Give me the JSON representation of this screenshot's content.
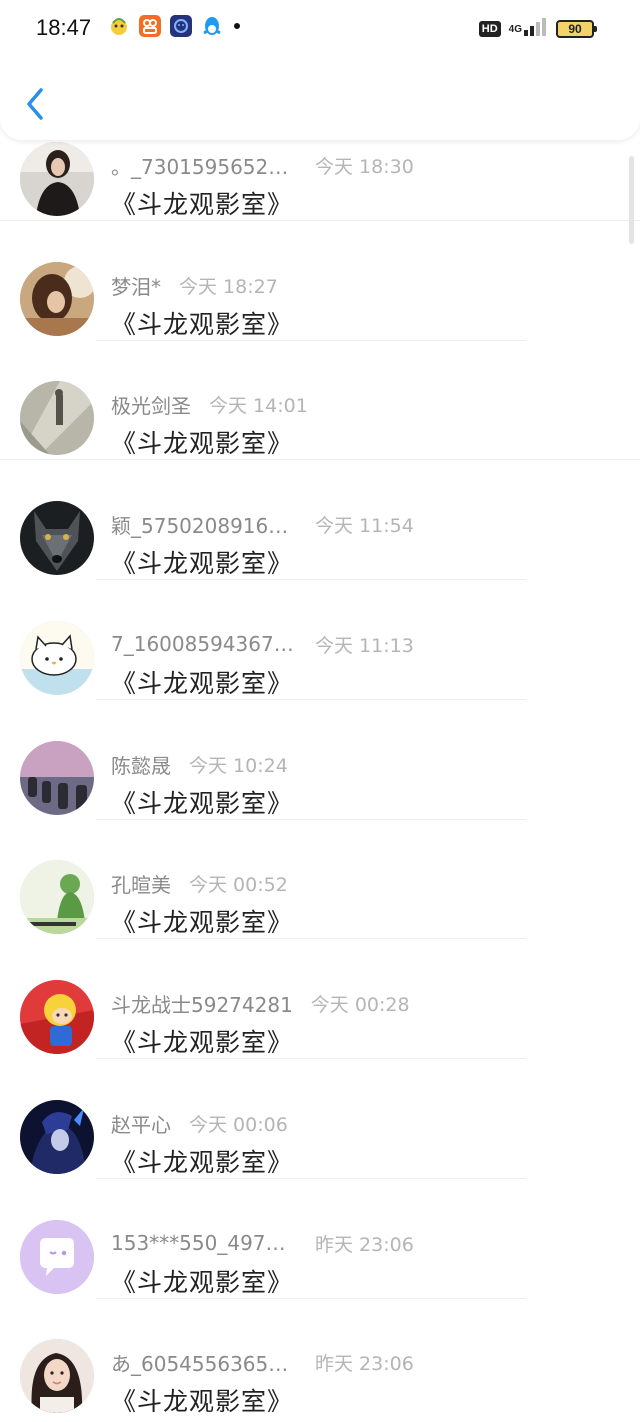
{
  "status_bar": {
    "time": "18:47",
    "hd": "HD",
    "network": "4G",
    "battery": "90"
  },
  "header": {
    "back_icon": "chevron-left-icon"
  },
  "messages": [
    {
      "name": "。_730159565233...",
      "time": "今天 18:30",
      "text": "《斗龙观影室》"
    },
    {
      "name": "梦泪*",
      "time": "今天 18:27",
      "text": "《斗龙观影室》"
    },
    {
      "name": "极光剑圣",
      "time": "今天 14:01",
      "text": "《斗龙观影室》"
    },
    {
      "name": "颖_575020891601...",
      "time": "今天 11:54",
      "text": "《斗龙观影室》"
    },
    {
      "name": "7_1600859436751...",
      "time": "今天 11:13",
      "text": "《斗龙观影室》"
    },
    {
      "name": "陈懿晟",
      "time": "今天 10:24",
      "text": "《斗龙观影室》"
    },
    {
      "name": "孔暄美",
      "time": "今天 00:52",
      "text": "《斗龙观影室》"
    },
    {
      "name": "斗龙战士59274281",
      "time": "今天 00:28",
      "text": "《斗龙观影室》"
    },
    {
      "name": "赵平心",
      "time": "今天 00:06",
      "text": "《斗龙观影室》"
    },
    {
      "name": "153***550_497593...",
      "time": "昨天 23:06",
      "text": "《斗龙观影室》"
    },
    {
      "name": "あ_605455636584...",
      "time": "昨天 23:06",
      "text": "《斗龙观影室》"
    }
  ],
  "colors": {
    "accent": "#2a8fe8",
    "name": "#8a8a8a",
    "time": "#b5b5b5",
    "message": "#222222"
  }
}
